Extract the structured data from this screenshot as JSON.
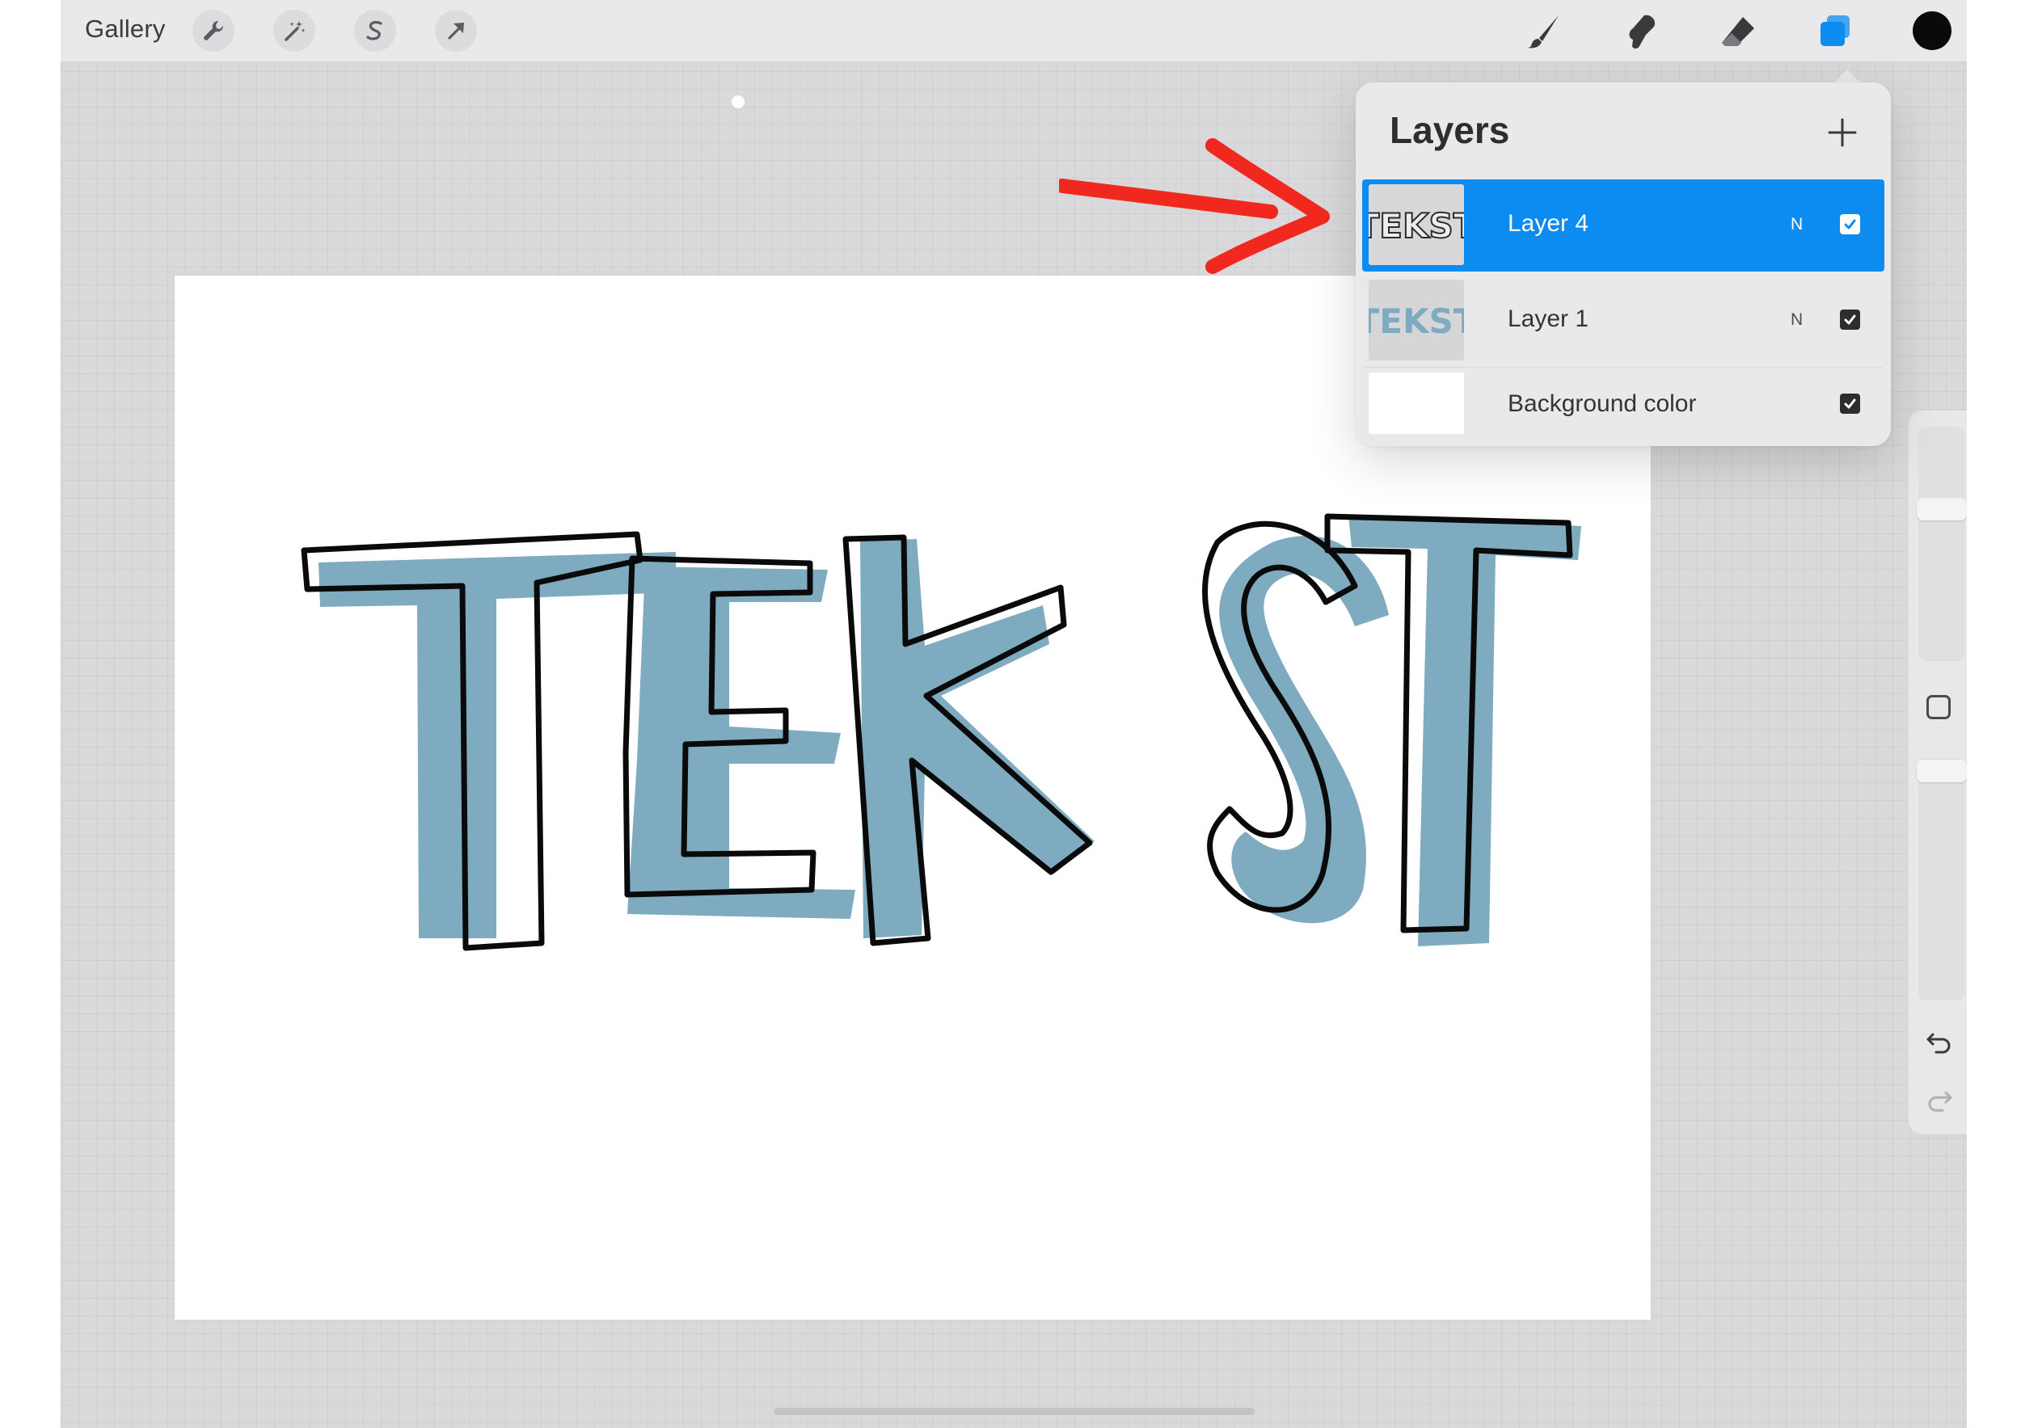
{
  "toolbar": {
    "gallery_label": "Gallery",
    "left_tools": [
      {
        "name": "actions",
        "icon": "wrench-icon"
      },
      {
        "name": "adjustments",
        "icon": "magic-wand-icon"
      },
      {
        "name": "selection",
        "icon": "selection-s-icon"
      },
      {
        "name": "transform",
        "icon": "arrow-cursor-icon"
      }
    ],
    "right_tools": [
      {
        "name": "brush",
        "icon": "brush-icon"
      },
      {
        "name": "smudge",
        "icon": "smudge-icon"
      },
      {
        "name": "eraser",
        "icon": "eraser-icon"
      },
      {
        "name": "layers",
        "icon": "layers-icon",
        "active": true
      }
    ],
    "active_color": "#0a0a0a",
    "accent_color": "#0c8cf0"
  },
  "layers_panel": {
    "title": "Layers",
    "add_icon": "plus-icon",
    "layers": [
      {
        "name": "Layer 4",
        "blend_mode": "N",
        "visible": true,
        "selected": true,
        "thumbnail": "TEKST"
      },
      {
        "name": "Layer 1",
        "blend_mode": "N",
        "visible": true,
        "selected": false,
        "thumbnail": "TEKST"
      },
      {
        "name": "Background color",
        "blend_mode": "",
        "visible": true,
        "selected": false,
        "thumbnail": ""
      }
    ]
  },
  "canvas": {
    "artwork_text": "TEKST",
    "fill_color": "#7eabc0",
    "outline_color": "#0a0a0a",
    "background": "#ffffff"
  },
  "sidebar": {
    "brush_size_level": 0.25,
    "opacity_level": 0.05,
    "icons": [
      "modify-square-icon",
      "undo-icon",
      "redo-icon"
    ]
  },
  "annotation": {
    "arrow_color": "#f0281e",
    "points_to": "Layer 4"
  }
}
